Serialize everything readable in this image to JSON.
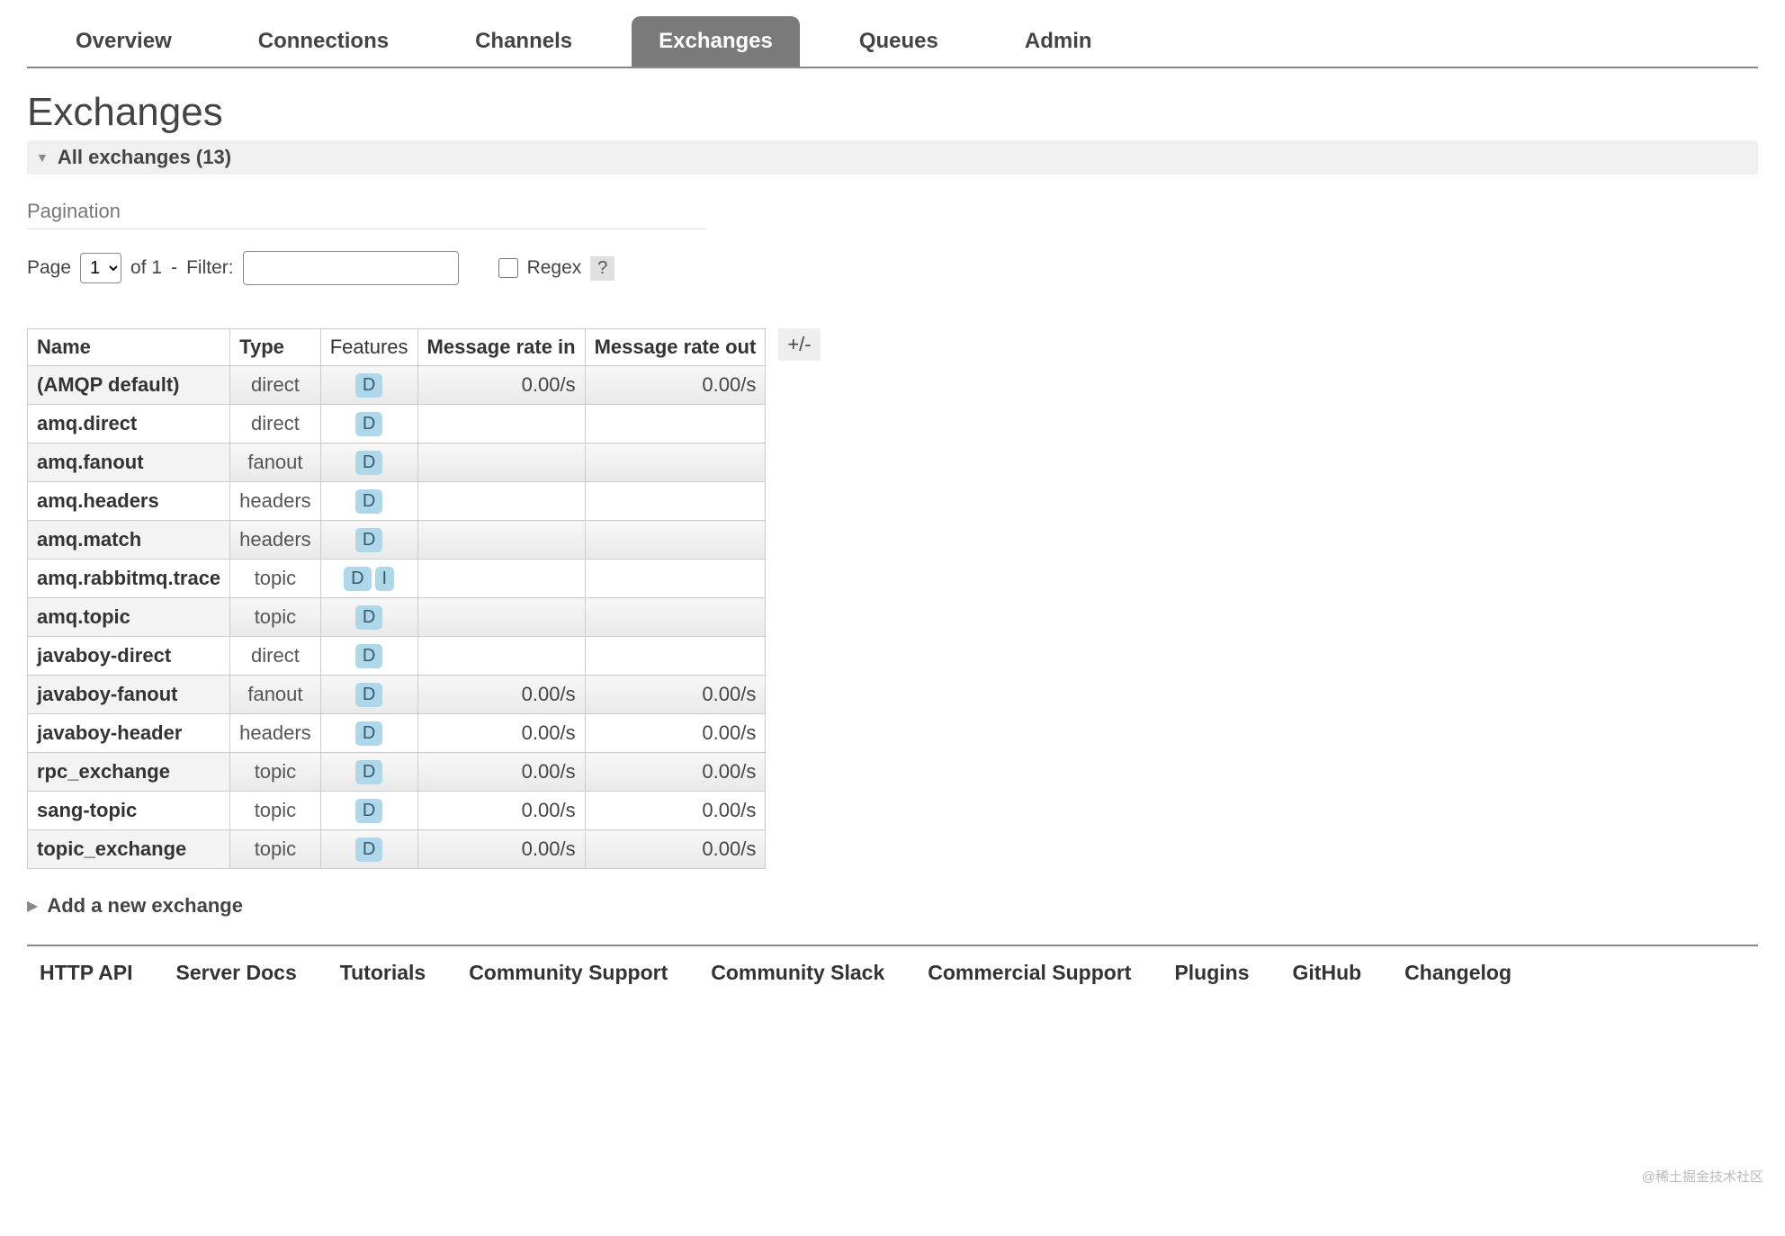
{
  "tabs": [
    {
      "label": "Overview",
      "selected": false
    },
    {
      "label": "Connections",
      "selected": false
    },
    {
      "label": "Channels",
      "selected": false
    },
    {
      "label": "Exchanges",
      "selected": true
    },
    {
      "label": "Queues",
      "selected": false
    },
    {
      "label": "Admin",
      "selected": false
    }
  ],
  "page_title": "Exchanges",
  "all_section": {
    "expanded": true,
    "title": "All exchanges (13)"
  },
  "pagination": {
    "section_label": "Pagination",
    "page_label": "Page",
    "page_options": [
      "1"
    ],
    "page_selected": "1",
    "of_label": "of 1",
    "separator": "-",
    "filter_label": "Filter:",
    "filter_value": "",
    "regex_checked": false,
    "regex_label": "Regex",
    "help": "?"
  },
  "table": {
    "headers": {
      "name": "Name",
      "type": "Type",
      "features": "Features",
      "rate_in": "Message rate in",
      "rate_out": "Message rate out"
    },
    "plus_minus": "+/-",
    "rows": [
      {
        "name": "(AMQP default)",
        "type": "direct",
        "features": [
          "D"
        ],
        "rate_in": "0.00/s",
        "rate_out": "0.00/s",
        "alt": true
      },
      {
        "name": "amq.direct",
        "type": "direct",
        "features": [
          "D"
        ],
        "rate_in": "",
        "rate_out": "",
        "alt": false
      },
      {
        "name": "amq.fanout",
        "type": "fanout",
        "features": [
          "D"
        ],
        "rate_in": "",
        "rate_out": "",
        "alt": true
      },
      {
        "name": "amq.headers",
        "type": "headers",
        "features": [
          "D"
        ],
        "rate_in": "",
        "rate_out": "",
        "alt": false
      },
      {
        "name": "amq.match",
        "type": "headers",
        "features": [
          "D"
        ],
        "rate_in": "",
        "rate_out": "",
        "alt": true
      },
      {
        "name": "amq.rabbitmq.trace",
        "type": "topic",
        "features": [
          "D",
          "I"
        ],
        "rate_in": "",
        "rate_out": "",
        "alt": false
      },
      {
        "name": "amq.topic",
        "type": "topic",
        "features": [
          "D"
        ],
        "rate_in": "",
        "rate_out": "",
        "alt": true
      },
      {
        "name": "javaboy-direct",
        "type": "direct",
        "features": [
          "D"
        ],
        "rate_in": "",
        "rate_out": "",
        "alt": false
      },
      {
        "name": "javaboy-fanout",
        "type": "fanout",
        "features": [
          "D"
        ],
        "rate_in": "0.00/s",
        "rate_out": "0.00/s",
        "alt": true
      },
      {
        "name": "javaboy-header",
        "type": "headers",
        "features": [
          "D"
        ],
        "rate_in": "0.00/s",
        "rate_out": "0.00/s",
        "alt": false
      },
      {
        "name": "rpc_exchange",
        "type": "topic",
        "features": [
          "D"
        ],
        "rate_in": "0.00/s",
        "rate_out": "0.00/s",
        "alt": true
      },
      {
        "name": "sang-topic",
        "type": "topic",
        "features": [
          "D"
        ],
        "rate_in": "0.00/s",
        "rate_out": "0.00/s",
        "alt": false
      },
      {
        "name": "topic_exchange",
        "type": "topic",
        "features": [
          "D"
        ],
        "rate_in": "0.00/s",
        "rate_out": "0.00/s",
        "alt": true
      }
    ]
  },
  "add_section": {
    "expanded": false,
    "title": "Add a new exchange"
  },
  "footer_links": [
    "HTTP API",
    "Server Docs",
    "Tutorials",
    "Community Support",
    "Community Slack",
    "Commercial Support",
    "Plugins",
    "GitHub",
    "Changelog"
  ],
  "watermark": "@稀土掘金技术社区"
}
